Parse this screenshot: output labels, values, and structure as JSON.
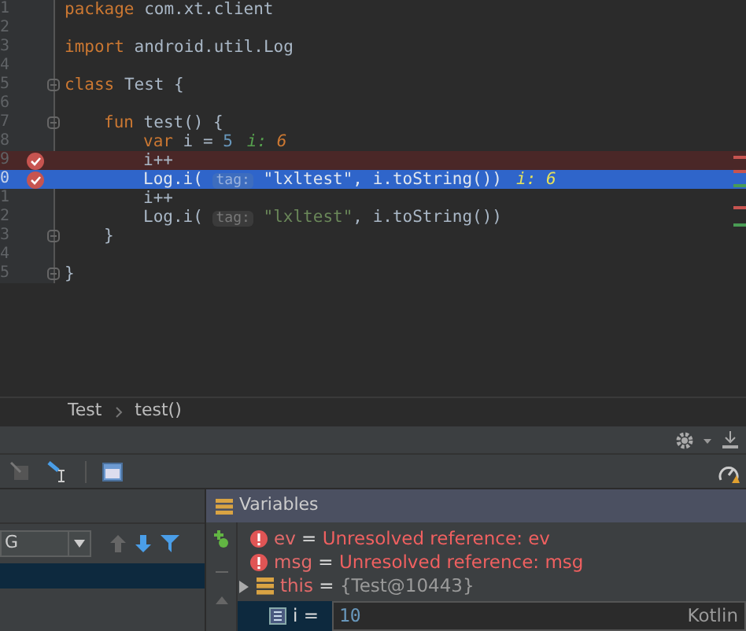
{
  "editor": {
    "lines": [
      {
        "number": "1",
        "code": [
          {
            "kind": "keyword",
            "text": "package "
          },
          {
            "kind": "plain",
            "text": "com.xt.client"
          }
        ]
      },
      {
        "number": "2"
      },
      {
        "number": "3",
        "code": [
          {
            "kind": "keyword",
            "text": "import "
          },
          {
            "kind": "plain",
            "text": "android.util.Log"
          }
        ]
      },
      {
        "number": "4"
      },
      {
        "number": "5",
        "fold": true,
        "code": [
          {
            "kind": "keyword",
            "text": "class "
          },
          {
            "kind": "plain",
            "text": "Test {"
          }
        ],
        "children": [
          {
            "number": "6"
          },
          {
            "number": "7",
            "fold": true,
            "code": [
              {
                "kind": "keyword",
                "text": "fun "
              },
              {
                "kind": "plain",
                "text": "test() {"
              }
            ],
            "children": [
              {
                "number": "8",
                "code": [
                  {
                    "kind": "keyword",
                    "text": "var "
                  },
                  {
                    "kind": "plain",
                    "text": "i = "
                  },
                  {
                    "kind": "number",
                    "text": "5"
                  }
                ],
                "inline": {
                  "name": "i:",
                  "value": "6",
                  "kind": "normal"
                }
              },
              {
                "number": "9",
                "breakpoint": true,
                "error": true,
                "code": [
                  {
                    "kind": "plain",
                    "text": "i++"
                  }
                ]
              },
              {
                "number": "0",
                "breakpoint": true,
                "execution_point": true,
                "code": [
                  {
                    "kind": "plain",
                    "text": "Log.i( "
                  },
                  {
                    "kind": "param",
                    "text": "tag:"
                  },
                  {
                    "kind": "string",
                    "text": " \"lxltest\""
                  },
                  {
                    "kind": "plain",
                    "text": ", i.toString())"
                  }
                ],
                "inline": {
                  "name": "i:",
                  "value": "6",
                  "kind": "current"
                }
              },
              {
                "number": "1",
                "code": [
                  {
                    "kind": "plain",
                    "text": "i++"
                  }
                ]
              },
              {
                "number": "2",
                "code": [
                  {
                    "kind": "plain",
                    "text": "Log.i( "
                  },
                  {
                    "kind": "param",
                    "text": "tag:"
                  },
                  {
                    "kind": "string",
                    "text": " \"lxltest\""
                  },
                  {
                    "kind": "plain",
                    "text": ", i.toString())"
                  }
                ]
              }
            ]
          },
          {
            "number": "3",
            "fold": true,
            "code": [
              {
                "kind": "plain",
                "text": "}"
              }
            ]
          }
        ]
      },
      {
        "number": "4"
      },
      {
        "number": "5",
        "fold": true,
        "code": [
          {
            "kind": "plain",
            "text": "}"
          }
        ]
      }
    ]
  },
  "breadcrumbs": [
    "Test",
    "test()"
  ],
  "frames": {
    "thread": "G"
  },
  "variables": {
    "title": "Variables",
    "items": [
      {
        "kind": "error",
        "name": "ev",
        "sep": "=",
        "value": "Unresolved reference: ev"
      },
      {
        "kind": "error",
        "name": "msg",
        "sep": "=",
        "value": "Unresolved reference: msg"
      },
      {
        "kind": "object",
        "name": "this",
        "sep": "=",
        "value": "{Test@10443}",
        "expanded": false
      },
      {
        "kind": "edit",
        "name": "i",
        "sep": "=",
        "value": "10",
        "language": "Kotlin"
      }
    ]
  }
}
